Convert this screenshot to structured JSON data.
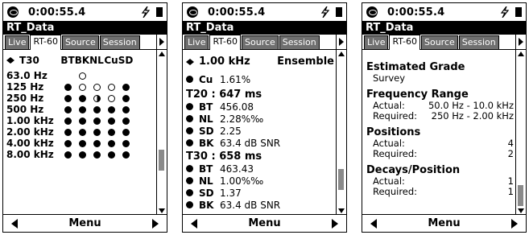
{
  "status": {
    "time": "0:00:55.4"
  },
  "title": "RT_Data",
  "tabs": [
    "Live",
    "RT-60",
    "Source",
    "Session"
  ],
  "menu_label": "Menu",
  "screen1": {
    "header": {
      "metric": "T30",
      "cols": [
        "BT",
        "BK",
        "NL",
        "Cu",
        "SD"
      ]
    },
    "rows": [
      {
        "freq": "63.0 Hz",
        "cells": [
          "",
          "empty",
          "",
          "",
          ""
        ]
      },
      {
        "freq": "125 Hz",
        "cells": [
          "full",
          "empty",
          "empty",
          "empty",
          "full"
        ]
      },
      {
        "freq": "250 Hz",
        "cells": [
          "full",
          "full",
          "half",
          "empty",
          "full"
        ]
      },
      {
        "freq": "500 Hz",
        "cells": [
          "full",
          "full",
          "full",
          "full",
          "full"
        ]
      },
      {
        "freq": "1.00 kHz",
        "cells": [
          "full",
          "full",
          "full",
          "full",
          "full"
        ]
      },
      {
        "freq": "2.00 kHz",
        "cells": [
          "full",
          "full",
          "full",
          "full",
          "full"
        ]
      },
      {
        "freq": "4.00 kHz",
        "cells": [
          "full",
          "full",
          "full",
          "full",
          "full"
        ]
      },
      {
        "freq": "8.00 kHz",
        "cells": [
          "full",
          "full",
          "full",
          "full",
          "full"
        ]
      }
    ]
  },
  "screen2": {
    "freq": "1.00 kHz",
    "mode": "Ensemble",
    "cu": {
      "label": "Cu",
      "value": "1.61%"
    },
    "t20": {
      "title": "T20 : 647 ms",
      "items": [
        {
          "label": "BT",
          "value": "456.08"
        },
        {
          "label": "NL",
          "value": "2.28%‰"
        },
        {
          "label": "SD",
          "value": "2.25"
        },
        {
          "label": "BK",
          "value": "63.4 dB SNR"
        }
      ]
    },
    "t30": {
      "title": "T30 : 658 ms",
      "items": [
        {
          "label": "BT",
          "value": "463.43"
        },
        {
          "label": "NL",
          "value": "1.00%‰"
        },
        {
          "label": "SD",
          "value": "1.37"
        },
        {
          "label": "BK",
          "value": "63.4 dB SNR"
        }
      ]
    }
  },
  "screen3": {
    "grade": {
      "title": "Estimated Grade",
      "value": "Survey"
    },
    "freq_range": {
      "title": "Frequency Range",
      "actual_label": "Actual:",
      "actual": "50.0 Hz - 10.0 kHz",
      "required_label": "Required:",
      "required": "250 Hz - 2.00 kHz"
    },
    "positions": {
      "title": "Positions",
      "actual_label": "Actual:",
      "actual": "4",
      "required_label": "Required:",
      "required": "2"
    },
    "decays": {
      "title": "Decays/Position",
      "actual_label": "Actual:",
      "actual": "1",
      "required_label": "Required:",
      "required": "1"
    }
  }
}
